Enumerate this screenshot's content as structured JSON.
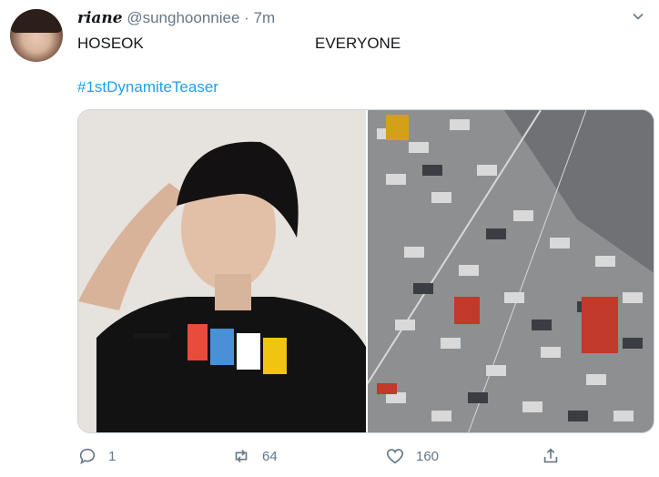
{
  "tweet": {
    "display_name": "riane",
    "handle": "@sunghoonniee",
    "separator": "·",
    "timestamp": "7m",
    "text_left": "HOSEOK",
    "text_right": "EVERYONE",
    "hashtag": "#1stDynamiteTeaser"
  },
  "actions": {
    "reply_count": "1",
    "retweet_count": "64",
    "like_count": "160"
  },
  "icons": {
    "more": "chevron-down-icon",
    "reply": "reply-icon",
    "retweet": "retweet-icon",
    "like": "heart-icon",
    "share": "share-icon"
  },
  "colors": {
    "link": "#1da1f2",
    "muted": "#657786",
    "text": "#14171a"
  }
}
